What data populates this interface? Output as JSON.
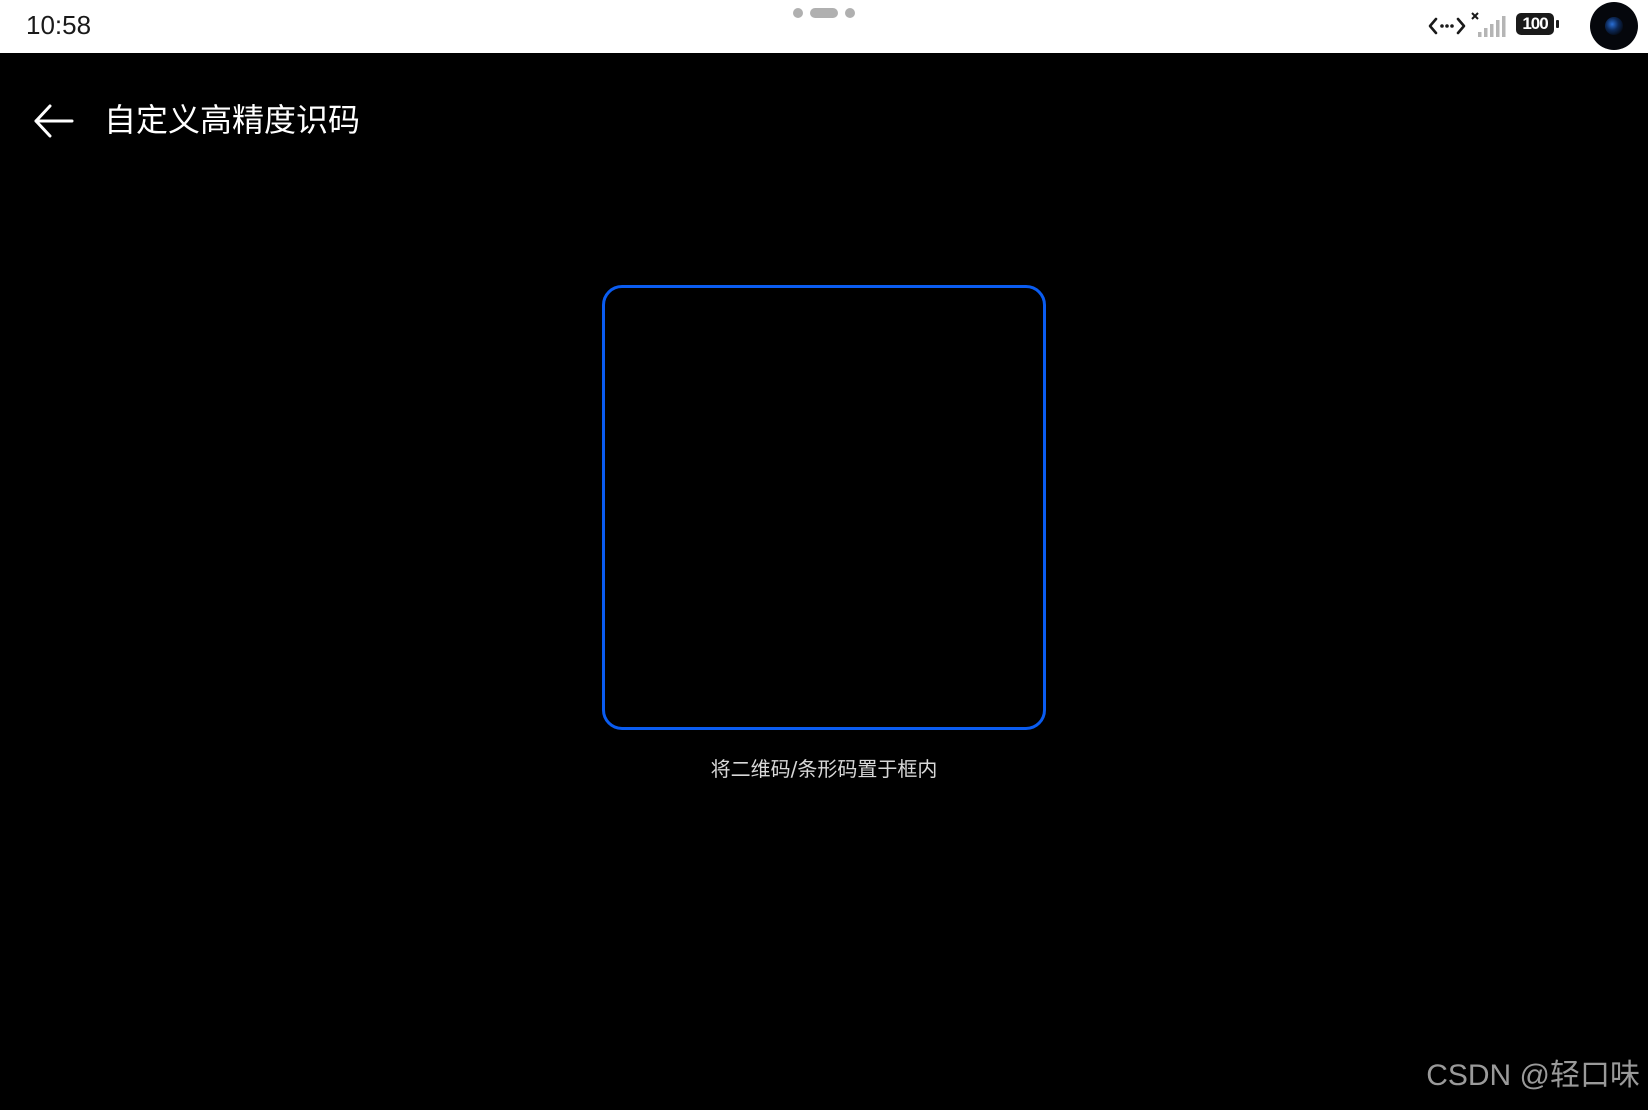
{
  "status_bar": {
    "time": "10:58",
    "battery_level": "100",
    "icons": [
      "data-exchange-icon",
      "no-signal-icon",
      "battery-icon",
      "camera-icon"
    ]
  },
  "header": {
    "back_icon": "arrow-left-icon",
    "title": "自定义高精度识码"
  },
  "scanner": {
    "frame_color": "#0a5cf0",
    "hint": "将二维码/条形码置于框内"
  },
  "watermark": "CSDN @轻口味"
}
